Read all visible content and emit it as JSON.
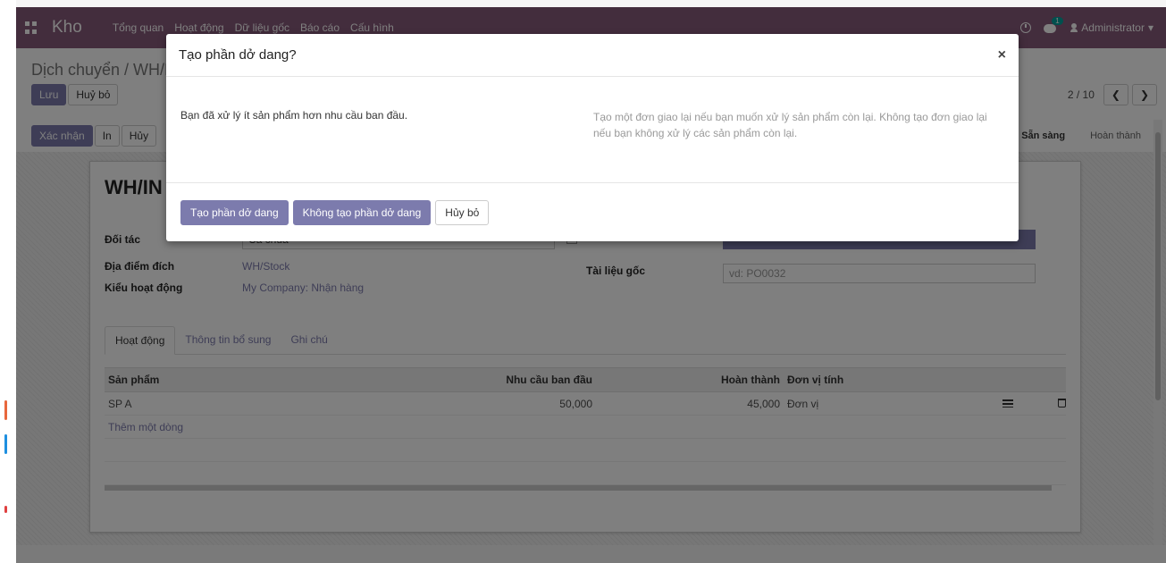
{
  "navbar": {
    "app_name": "Kho",
    "menu": [
      "Tổng quan",
      "Hoạt động",
      "Dữ liệu gốc",
      "Báo cáo",
      "Cấu hình"
    ],
    "notification_count": "1",
    "user": "Administrator"
  },
  "control_panel": {
    "breadcrumb": "Dịch chuyển / WH/IN",
    "save_label": "Lưu",
    "discard_label": "Huỷ bỏ",
    "pager": "2 / 10"
  },
  "statusbar": {
    "validate_label": "Xác nhận",
    "print_label": "In",
    "cancel_label": "Hủy",
    "stages": [
      "Sẵn sàng",
      "Hoàn thành"
    ]
  },
  "form": {
    "record_name": "WH/IN",
    "partner_label": "Đối tác",
    "partner_value": "Cà chua",
    "dest_label": "Địa điểm đích",
    "dest_value": "WH/Stock",
    "op_type_label": "Kiểu hoạt động",
    "op_type_value": "My Company: Nhận hàng",
    "source_doc_label": "Tài liệu gốc",
    "source_doc_placeholder": "vd: PO0032",
    "tabs": [
      "Hoạt động",
      "Thông tin bổ sung",
      "Ghi chú"
    ],
    "table_headers": [
      "Sản phẩm",
      "Nhu cầu ban đầu",
      "Hoàn thành",
      "Đơn vị tính"
    ],
    "rows": [
      {
        "product": "SP A",
        "demand": "50,000",
        "done": "45,000",
        "uom": "Đơn vị"
      }
    ],
    "add_line": "Thêm một dòng"
  },
  "modal": {
    "title": "Tạo phần dở dang?",
    "body_left": "Bạn đã xử lý ít sản phẩm hơn nhu cầu ban đầu.",
    "body_right": "Tạo một đơn giao lại nếu bạn muốn xử lý sản phẩm còn lại. Không tạo đơn giao lại nếu bạn không xử lý các sản phẩm còn lại.",
    "btn_create": "Tạo phần dở dang",
    "btn_no_create": "Không tạo phần dở dang",
    "btn_cancel": "Hủy bỏ"
  }
}
